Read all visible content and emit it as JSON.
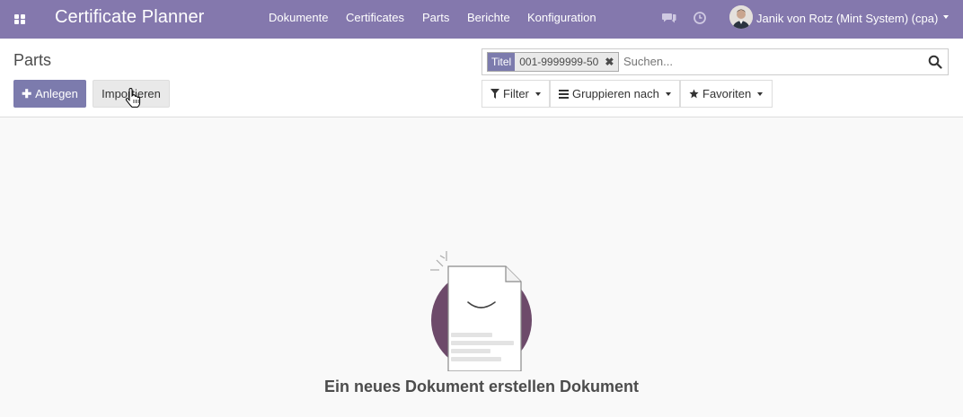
{
  "app": {
    "title": "Certificate Planner",
    "accent_color": "#8478ad",
    "primary_button_color": "#7c7bad"
  },
  "navbar": {
    "apps_icon": "apps-grid-icon",
    "menu": [
      {
        "label": "Dokumente"
      },
      {
        "label": "Certificates"
      },
      {
        "label": "Parts"
      },
      {
        "label": "Berichte"
      },
      {
        "label": "Konfiguration"
      }
    ],
    "icons": [
      "chat-icon",
      "clock-icon"
    ],
    "user": {
      "name": "Janik von Rotz (Mint System) (cpa)"
    }
  },
  "control_panel": {
    "breadcrumb": "Parts",
    "create_button": "Anlegen",
    "import_button": "Importieren",
    "search": {
      "facet_label": "Titel",
      "facet_value": "001-9999999-50",
      "placeholder": "Suchen..."
    },
    "filter_label": "Filter",
    "group_by_label": "Gruppieren nach",
    "favorites_label": "Favoriten"
  },
  "empty_state": {
    "help_text": "Ein neues Dokument erstellen Dokument"
  }
}
